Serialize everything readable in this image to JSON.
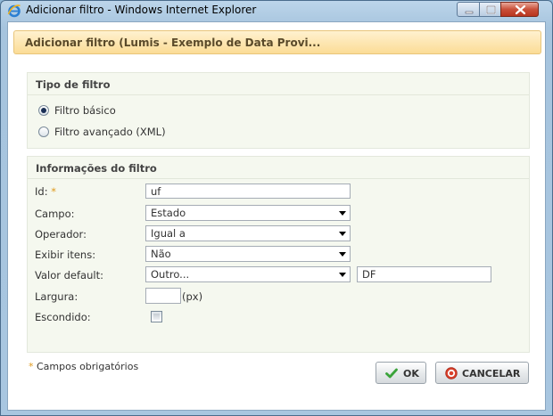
{
  "window": {
    "title": "Adicionar filtro - Windows Internet Explorer",
    "icon": "ie-icon",
    "controls": [
      "minimize-icon",
      "maximize-icon",
      "close-icon"
    ]
  },
  "dialog": {
    "title": "Adicionar filtro (Lumis - Exemplo de Data Provi..."
  },
  "filter_type": {
    "title": "Tipo de filtro",
    "options": [
      {
        "label": "Filtro básico",
        "selected": true
      },
      {
        "label": "Filtro avançado (XML)",
        "selected": false
      }
    ]
  },
  "filter_info": {
    "title": "Informações do filtro",
    "id": {
      "label": "Id:",
      "required_mark": "*",
      "value": "uf"
    },
    "campo": {
      "label": "Campo:",
      "value": "Estado"
    },
    "operador": {
      "label": "Operador:",
      "value": "Igual a"
    },
    "exibir_itens": {
      "label": "Exibir itens:",
      "value": "Não"
    },
    "valor_default": {
      "label": "Valor default:",
      "value": "Outro...",
      "other_value": "DF"
    },
    "largura": {
      "label": "Largura:",
      "value": "",
      "suffix": "(px)"
    },
    "escondido": {
      "label": "Escondido:",
      "checked": false
    }
  },
  "footer": {
    "required_mark": "*",
    "required_note": "Campos obrigatórios",
    "ok_label": "OK",
    "cancel_label": "CANCELAR"
  },
  "colors": {
    "header_bg": "#fbdc96",
    "section_bg": "#f5f8ef",
    "required": "#e09a1c",
    "ok_icon": "#3aa33a",
    "cancel_icon": "#d9402b"
  }
}
